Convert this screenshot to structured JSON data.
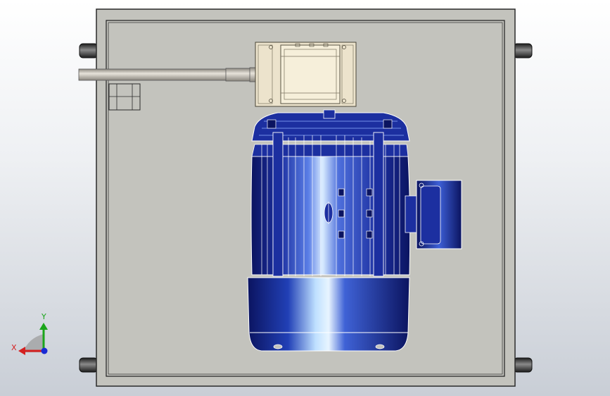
{
  "viewport": {
    "background_top": "#ffffff",
    "background_bottom": "#c9ced6"
  },
  "colors": {
    "plate": "#c3c3bd",
    "plate_edge": "#2b2b2b",
    "motor_blue": "#1c2fa0",
    "motor_dark": "#0b1460",
    "motor_highlight": "#cfe6ff",
    "junction_box": "#ece3cc",
    "shaft": "#b4b0a8",
    "foot_rubber": "#2e2e2e"
  },
  "triad": {
    "x_label": "X",
    "y_label": "Y",
    "x_color": "#d42020",
    "y_color": "#1aa51a",
    "z_color": "#1a2ad4"
  }
}
